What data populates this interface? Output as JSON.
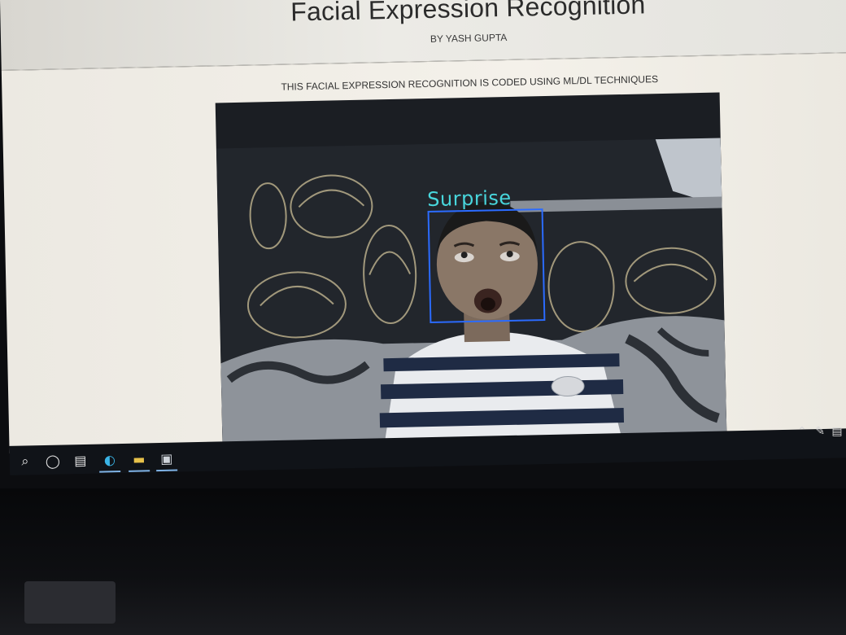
{
  "header": {
    "title": "Facial Expression Recognition",
    "subtitle": "BY YASH GUPTA"
  },
  "main": {
    "description": "THIS FACIAL EXPRESSION RECOGNITION IS CODED USING ML/DL TECHNIQUES",
    "video": {
      "expression_label": "Surprise",
      "label_color": "#48d6dc",
      "box_color": "#2b6bff"
    }
  },
  "taskbar": {
    "icons": [
      "search-icon",
      "cortana-icon",
      "task-view-icon",
      "edge-icon",
      "file-explorer-icon",
      "app-icon"
    ],
    "tray": [
      "chevron-up-icon",
      "pen-icon",
      "notification-icon"
    ]
  }
}
